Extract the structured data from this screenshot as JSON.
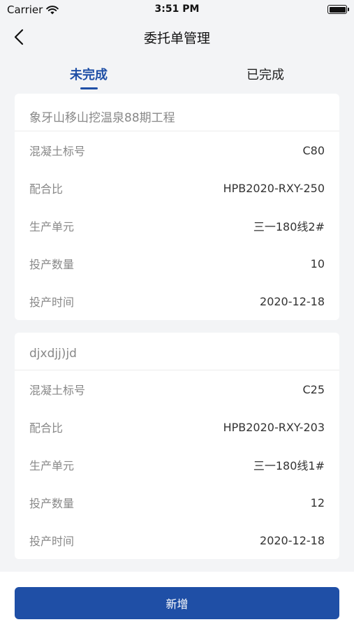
{
  "status_bar": {
    "carrier": "Carrier",
    "time": "3:51 PM"
  },
  "nav": {
    "title": "委托单管理"
  },
  "tabs": [
    {
      "label": "未完成",
      "active": true
    },
    {
      "label": "已完成",
      "active": false
    }
  ],
  "orders": [
    {
      "title": "象牙山移山挖温泉88期工程",
      "rows": [
        {
          "label": "混凝土标号",
          "value": "C80"
        },
        {
          "label": "配合比",
          "value": "HPB2020-RXY-250"
        },
        {
          "label": "生产单元",
          "value": "三一180线2#"
        },
        {
          "label": "投产数量",
          "value": "10"
        },
        {
          "label": "投产时间",
          "value": "2020-12-18"
        }
      ]
    },
    {
      "title": "djxdjj)jd",
      "rows": [
        {
          "label": "混凝土标号",
          "value": "C25"
        },
        {
          "label": "配合比",
          "value": "HPB2020-RXY-203"
        },
        {
          "label": "生产单元",
          "value": "三一180线1#"
        },
        {
          "label": "投产数量",
          "value": "12"
        },
        {
          "label": "投产时间",
          "value": "2020-12-18"
        }
      ]
    }
  ],
  "footer": {
    "add_label": "新增"
  },
  "colors": {
    "accent": "#1f4fa6",
    "background": "#f3f4f6"
  }
}
